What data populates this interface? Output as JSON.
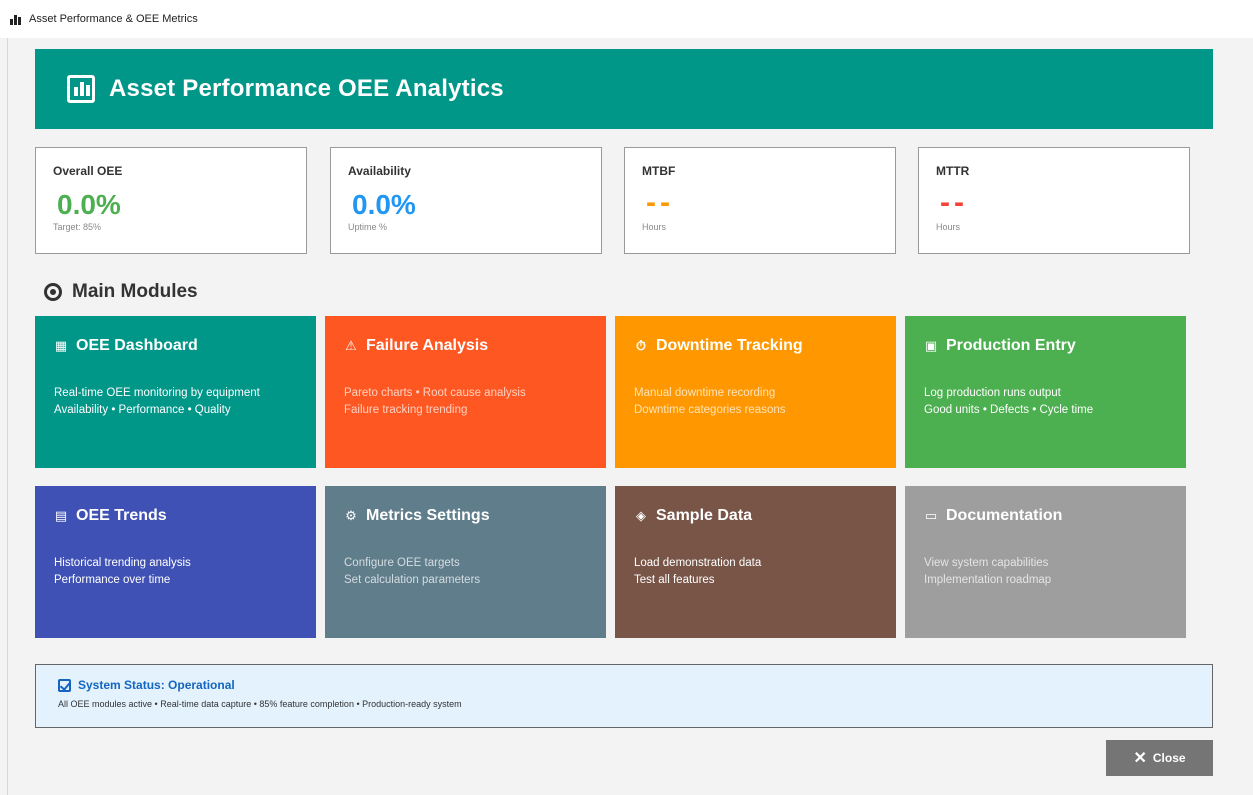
{
  "window": {
    "title": "Asset Performance & OEE Metrics"
  },
  "header": {
    "title": "Asset Performance  OEE Analytics",
    "icon": "bar-chart-icon"
  },
  "metrics": [
    {
      "label": "Overall OEE",
      "value": "0.0%",
      "sub": "Target: 85%",
      "color": "#4caf50"
    },
    {
      "label": "Availability",
      "value": "0.0%",
      "sub": "Uptime %",
      "color": "#2196f3"
    },
    {
      "label": "MTBF",
      "value": "--",
      "sub": "Hours",
      "color": "#ff9800"
    },
    {
      "label": "MTTR",
      "value": "--",
      "sub": "Hours",
      "color": "#f44336"
    }
  ],
  "section": {
    "title": "Main Modules",
    "icon": "target-icon"
  },
  "modules": [
    {
      "title": "OEE Dashboard",
      "icon": "chart-icon",
      "glyph": "▦",
      "lines": [
        "Real-time OEE monitoring by equipment",
        "Availability • Performance • Quality"
      ],
      "color": "#009688"
    },
    {
      "title": "Failure Analysis",
      "icon": "warning-icon",
      "glyph": "⚠",
      "lines": [
        "Pareto charts • Root cause analysis",
        "Failure tracking  trending"
      ],
      "color": "#ff5722"
    },
    {
      "title": "Downtime Tracking",
      "icon": "stopwatch-icon",
      "glyph": "⏱",
      "lines": [
        "Manual downtime recording",
        "Downtime categories  reasons"
      ],
      "color": "#ff9800"
    },
    {
      "title": "Production Entry",
      "icon": "clipboard-icon",
      "glyph": "▣",
      "lines": [
        "Log production runs  output",
        "Good units • Defects • Cycle time"
      ],
      "color": "#4caf50"
    },
    {
      "title": "OEE Trends",
      "icon": "trend-chart-icon",
      "glyph": "▤",
      "lines": [
        "Historical trending  analysis",
        "Performance over time"
      ],
      "color": "#3f51b5"
    },
    {
      "title": "Metrics Settings",
      "icon": "gear-icon",
      "glyph": "⚙",
      "lines": [
        "Configure OEE targets",
        "Set calculation parameters"
      ],
      "color": "#607d8b"
    },
    {
      "title": "Sample Data",
      "icon": "package-icon",
      "glyph": "◈",
      "lines": [
        "Load demonstration data",
        "Test all features"
      ],
      "color": "#795548"
    },
    {
      "title": "Documentation",
      "icon": "book-icon",
      "glyph": "▭",
      "lines": [
        "View system capabilities",
        "Implementation roadmap"
      ],
      "color": "#9e9e9e"
    }
  ],
  "status": {
    "title": "System Status: Operational",
    "text": "All OEE modules active • Real-time data capture • 85% feature completion • Production-ready system"
  },
  "close_button": {
    "label": "Close",
    "icon": "close-icon"
  }
}
